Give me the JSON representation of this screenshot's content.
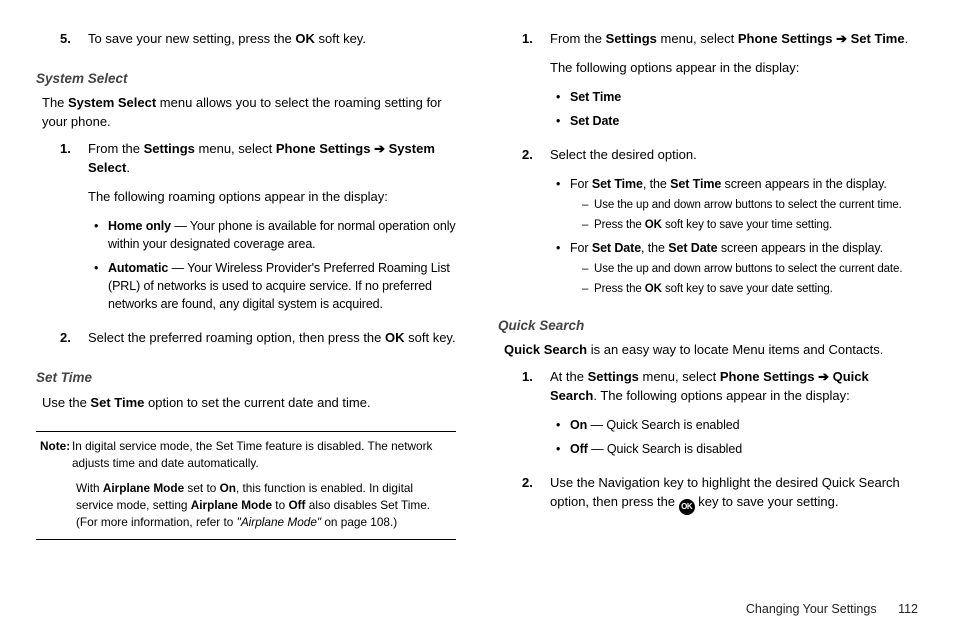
{
  "footer": {
    "section": "Changing Your Settings",
    "page": "112"
  },
  "arrow": "➔",
  "left": {
    "step5": {
      "num": "5.",
      "a": "To save your new setting, press the ",
      "b": "OK",
      "c": " soft key."
    },
    "system_select": {
      "heading": "System Select",
      "intro_a": "The ",
      "intro_b": "System Select",
      "intro_c": " menu allows you to select the roaming setting for your phone.",
      "s1": {
        "num": "1.",
        "a": "From the ",
        "b": "Settings",
        "c": " menu, select ",
        "d": "Phone Settings",
        "e": "System Select",
        "f": ".",
        "line2": "The following roaming options appear in the display:",
        "bul1_a": "Home only",
        "bul1_b": " — Your phone is available for normal operation only within your designated coverage area.",
        "bul2_a": "Automatic",
        "bul2_b": " — Your Wireless Provider's Preferred Roaming List (PRL) of networks is used to acquire service. If no preferred networks are found, any digital system is acquired."
      },
      "s2": {
        "num": "2.",
        "a": "Select the preferred roaming option, then press the ",
        "b": "OK",
        "c": " soft key."
      }
    },
    "set_time": {
      "heading": "Set Time",
      "intro_a": "Use the ",
      "intro_b": "Set Time",
      "intro_c": " option to set the current date and time."
    },
    "note": {
      "label": "Note:",
      "p1": "In digital service mode, the Set Time feature is disabled. The network adjusts time and date automatically.",
      "p2_a": "With ",
      "p2_b": "Airplane Mode",
      "p2_c": " set to ",
      "p2_d": "On",
      "p2_e": ", this function is enabled. In digital service mode, setting ",
      "p2_f": "Airplane Mode",
      "p2_g": " to ",
      "p2_h": "Off",
      "p2_i": " also disables Set Time. (For more information, refer to ",
      "p2_j": "\"Airplane Mode\"",
      "p2_k": "  on page 108.)"
    }
  },
  "right": {
    "s1": {
      "num": "1.",
      "a": "From the ",
      "b": "Settings",
      "c": " menu, select ",
      "d": "Phone Settings",
      "e": "Set Time",
      "f": ".",
      "line2": "The following options appear in the display:",
      "bul1": "Set Time",
      "bul2": "Set Date"
    },
    "s2": {
      "num": "2.",
      "a": "Select the desired option.",
      "bul1_a": "For ",
      "bul1_b": "Set Time",
      "bul1_c": ", the ",
      "bul1_d": "Set Time",
      "bul1_e": " screen appears in the display.",
      "d1_a": "Use the up and down arrow buttons to select the current time.",
      "d1_b_a": "Press the ",
      "d1_b_b": "OK",
      "d1_b_c": " soft key to save your time setting.",
      "bul2_a": "For ",
      "bul2_b": "Set Date",
      "bul2_c": ", the ",
      "bul2_d": "Set Date",
      "bul2_e": " screen appears in the display.",
      "d2_a": "Use the up and down arrow buttons to select the current date.",
      "d2_b_a": "Press the ",
      "d2_b_b": "OK",
      "d2_b_c": " soft key to save your date setting."
    },
    "quick_search": {
      "heading": "Quick Search",
      "intro_a": "Quick Search",
      "intro_b": " is an easy way to locate Menu items and Contacts.",
      "q1": {
        "num": "1.",
        "a": "At the ",
        "b": "Settings",
        "c": " menu, select ",
        "d": "Phone Settings",
        "e": "Quick Search",
        "f": ". The following options appear in the display:",
        "bul1_a": "On",
        "bul1_b": " — Quick Search is enabled",
        "bul2_a": "Off",
        "bul2_b": " — Quick Search is disabled"
      },
      "q2": {
        "num": "2.",
        "a": "Use the Navigation key to highlight the desired Quick Search option, then press the ",
        "b": " key to save your setting."
      }
    }
  }
}
